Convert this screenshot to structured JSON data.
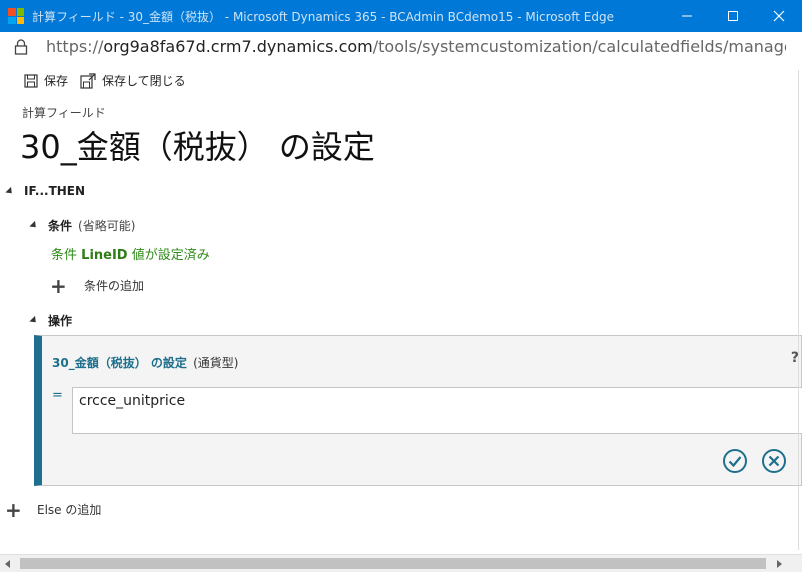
{
  "window": {
    "title": "計算フィールド - 30_金額（税抜） - Microsoft Dynamics 365 - BCAdmin BCdemo15 - Microsoft Edge",
    "logo_colors": [
      "#f25022",
      "#7fba00",
      "#00a4ef",
      "#ffb900"
    ],
    "controls": {
      "minimize": "─",
      "maximize": "☐",
      "close": "✕"
    }
  },
  "address": {
    "host_prefix": "https://",
    "host": "org9a8fa67d.crm7.dynamics.com",
    "path": "/tools/systemcustomization/calculatedfields/manageCalculate..."
  },
  "toolbar": {
    "save_label": "保存",
    "save_close_label": "保存して閉じる"
  },
  "header": {
    "subtitle": "計算フィールド",
    "title": "30_金額（税抜） の設定"
  },
  "ifthen": {
    "label": "IF...THEN"
  },
  "conditions": {
    "label": "条件",
    "optional": "(省略可能)",
    "line_prefix": "条件",
    "field": "LineID",
    "line_suffix": "値が設定済み",
    "add_label": "条件の追加"
  },
  "actions": {
    "label": "操作",
    "panel_title": "30_金額（税抜） の設定",
    "panel_type": "(通貨型)",
    "help": "?",
    "equals": "=",
    "expression": "crcce_unitprice"
  },
  "else": {
    "add_label": "Else の追加"
  },
  "colors": {
    "accent": "#1f6e8e",
    "condition_green": "#2f8a1a",
    "titlebar": "#0078d7"
  }
}
